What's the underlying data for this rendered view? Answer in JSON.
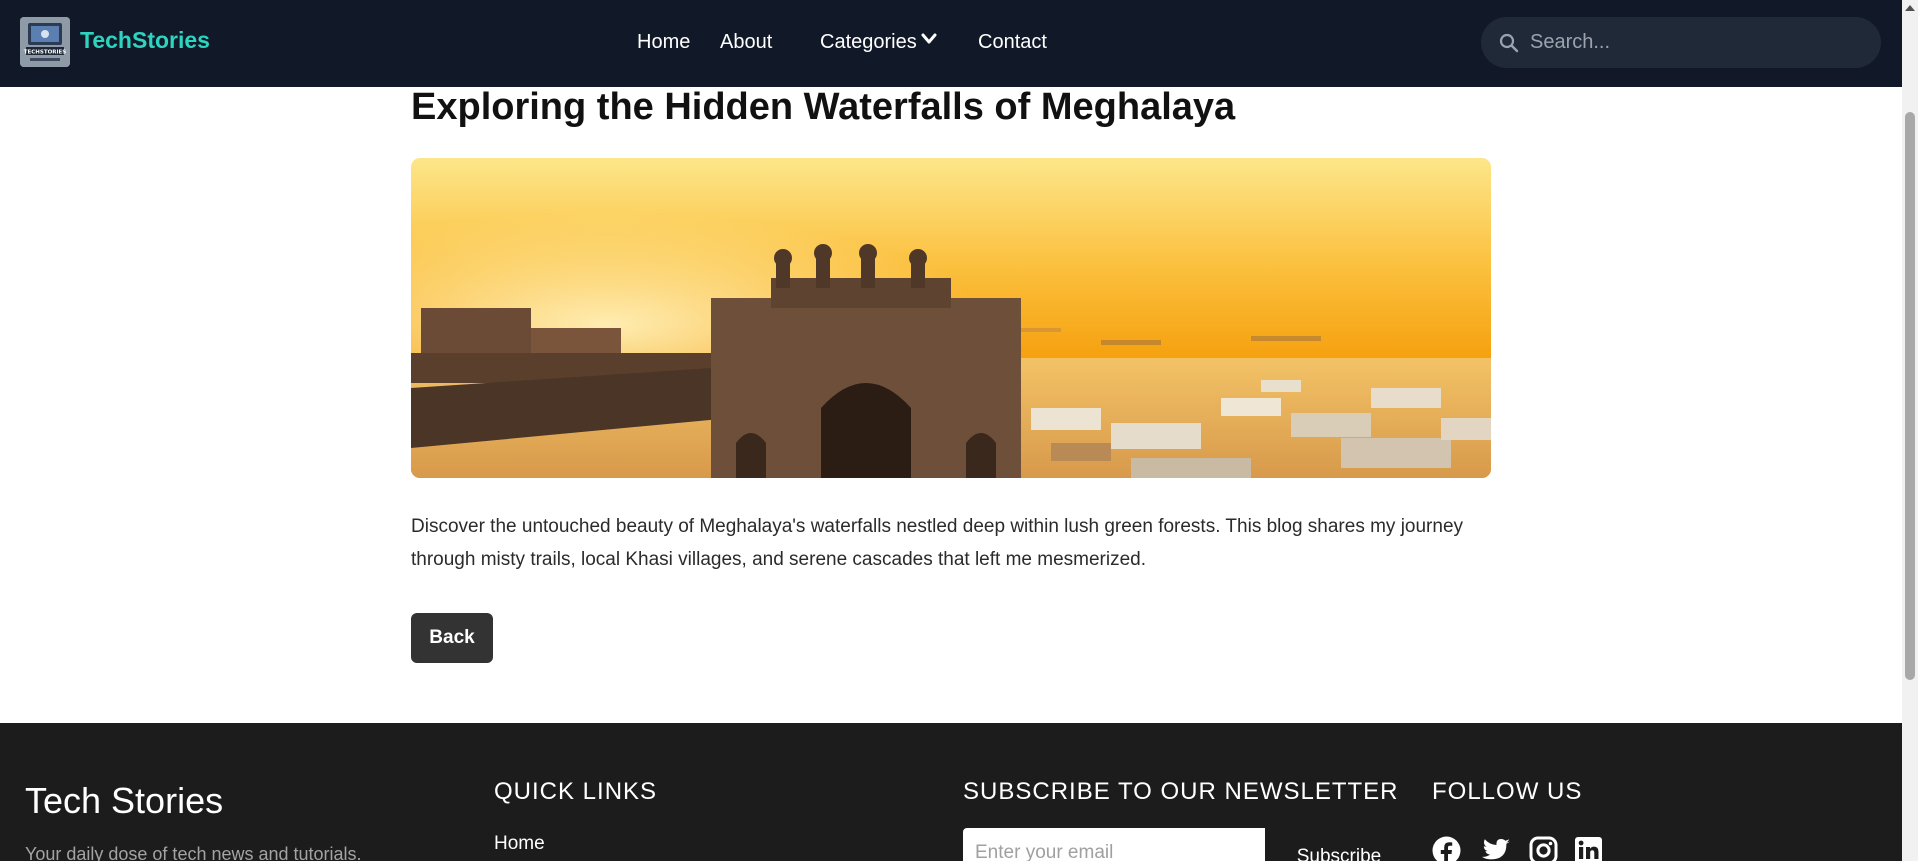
{
  "navbar": {
    "brand": "TechStories",
    "logo_text": "TECHSTORIES",
    "links": [
      "Home",
      "About",
      "Categories",
      "Contact"
    ],
    "search_placeholder": "Search..."
  },
  "article": {
    "title": "Exploring the Hidden Waterfalls of Meghalaya",
    "description": "Discover the untouched beauty of Meghalaya's waterfalls nestled deep within lush green forests. This blog shares my journey through misty trails, local Khasi villages, and serene cascades that left me mesmerized.",
    "back_label": "Back"
  },
  "footer": {
    "brand": "Tech Stories",
    "tagline": "Your daily dose of tech news and tutorials.",
    "quick_links_heading": "QUICK LINKS",
    "quick_links": [
      "Home"
    ],
    "newsletter_heading": "SUBSCRIBE TO OUR NEWSLETTER",
    "email_placeholder": "Enter your email",
    "subscribe_label": "Subscribe",
    "follow_heading": "FOLLOW US",
    "social_icons": [
      "facebook-icon",
      "twitter-icon",
      "instagram-icon",
      "linkedin-icon"
    ]
  },
  "colors": {
    "navbar_bg": "#111827",
    "brand_accent": "#2dd4bf",
    "footer_bg": "#1c1c1c",
    "button_bg": "#333333"
  }
}
